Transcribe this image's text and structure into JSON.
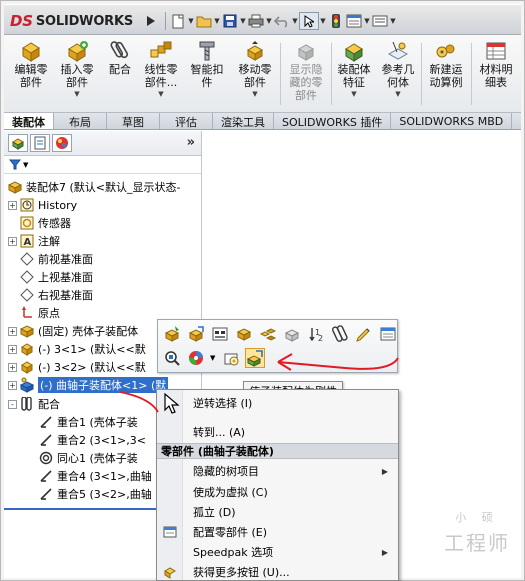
{
  "app": {
    "brand": "SOLIDWORKS",
    "brand_mark": "DS"
  },
  "ribbon": {
    "buttons": [
      {
        "label": "编辑零\n部件",
        "icon": "edit-component-icon"
      },
      {
        "label": "插入零\n部件",
        "icon": "insert-component-icon",
        "has_dropdown": true
      },
      {
        "label": "配合",
        "icon": "mate-icon"
      },
      {
        "label": "线性零\n部件...",
        "icon": "linear-pattern-icon",
        "has_dropdown": true
      },
      {
        "label": "智能扣\n件",
        "icon": "smart-fastener-icon"
      },
      {
        "label": "移动零\n部件",
        "icon": "move-component-icon",
        "has_dropdown": true
      },
      {
        "label": "显示隐\n藏的零\n部件",
        "icon": "show-hidden-icon",
        "disabled": true
      },
      {
        "label": "装配体\n特征",
        "icon": "assembly-feature-icon",
        "has_dropdown": true
      },
      {
        "label": "参考几\n何体",
        "icon": "reference-geometry-icon",
        "has_dropdown": true
      },
      {
        "label": "新建运\n动算例",
        "icon": "motion-study-icon"
      },
      {
        "label": "材料明\n细表",
        "icon": "bom-icon"
      }
    ]
  },
  "tabs": [
    {
      "label": "装配体",
      "active": true
    },
    {
      "label": "布局"
    },
    {
      "label": "草图"
    },
    {
      "label": "评估"
    },
    {
      "label": "渲染工具"
    },
    {
      "label": "SOLIDWORKS 插件"
    },
    {
      "label": "SOLIDWORKS MBD"
    }
  ],
  "feature_manager": {
    "more": "»",
    "tree": [
      {
        "label": "装配体7  (默认<默认_显示状态-",
        "icon": "assembly-icon",
        "indent": 0
      },
      {
        "label": "History",
        "icon": "history-icon",
        "indent": 1,
        "expander": "+"
      },
      {
        "label": "传感器",
        "icon": "sensor-icon",
        "indent": 1
      },
      {
        "label": "注解",
        "icon": "annotation-icon",
        "indent": 1,
        "expander": "+"
      },
      {
        "label": "前视基准面",
        "icon": "plane-icon",
        "indent": 1
      },
      {
        "label": "上视基准面",
        "icon": "plane-icon",
        "indent": 1
      },
      {
        "label": "右视基准面",
        "icon": "plane-icon",
        "indent": 1
      },
      {
        "label": "原点",
        "icon": "origin-icon",
        "indent": 1
      },
      {
        "label": "(固定) 壳体子装配体",
        "icon": "subassembly-icon",
        "indent": 1,
        "expander": "+"
      },
      {
        "label": "(-) 3<1> (默认<<默",
        "icon": "part-icon",
        "indent": 1,
        "expander": "+"
      },
      {
        "label": "(-) 3<2> (默认<<默",
        "icon": "part-icon",
        "indent": 1,
        "expander": "+"
      },
      {
        "label": "(-) 曲轴子装配体<1> (默",
        "icon": "flexible-subassembly-icon",
        "indent": 1,
        "expander": "+",
        "selected": true
      },
      {
        "label": "配合",
        "icon": "mates-folder-icon",
        "indent": 0,
        "expander": "-"
      },
      {
        "label": "重合1 (壳体子装",
        "icon": "coincident-mate-icon",
        "indent": 2
      },
      {
        "label": "重合2 (3<1>,3<",
        "icon": "coincident-mate-icon",
        "indent": 2
      },
      {
        "label": "同心1 (壳体子装",
        "icon": "concentric-mate-icon",
        "indent": 2
      },
      {
        "label": "重合4 (3<1>,曲轴",
        "icon": "coincident-mate-icon",
        "indent": 2
      },
      {
        "label": "重合5 (3<2>,曲轴",
        "icon": "coincident-mate-icon",
        "indent": 2
      }
    ]
  },
  "tooltip": {
    "text": "使子装配体为刚性"
  },
  "context_menu": {
    "items_top": [
      {
        "label": "逆转选择 (I)",
        "icon": "invert-selection-icon"
      },
      {
        "label": "转到... (A)"
      }
    ],
    "header": "零部件 (曲轴子装配体)",
    "items": [
      {
        "label": "隐藏的树项目",
        "submenu": true
      },
      {
        "label": "使成为虚拟 (C)"
      },
      {
        "label": "孤立 (D)"
      },
      {
        "label": "配置零部件 (E)",
        "icon": "configure-component-icon"
      },
      {
        "label": "Speedpak 选项",
        "submenu": true
      },
      {
        "label": "获得更多按钮 (U)...",
        "icon": "more-icon"
      }
    ]
  },
  "watermark": {
    "line1": "小 硕",
    "line2": "工程师"
  },
  "colors": {
    "accent_red": "#e01b24",
    "selection_blue": "#2f6ec9",
    "menu_bg": "#f6f6f6"
  }
}
